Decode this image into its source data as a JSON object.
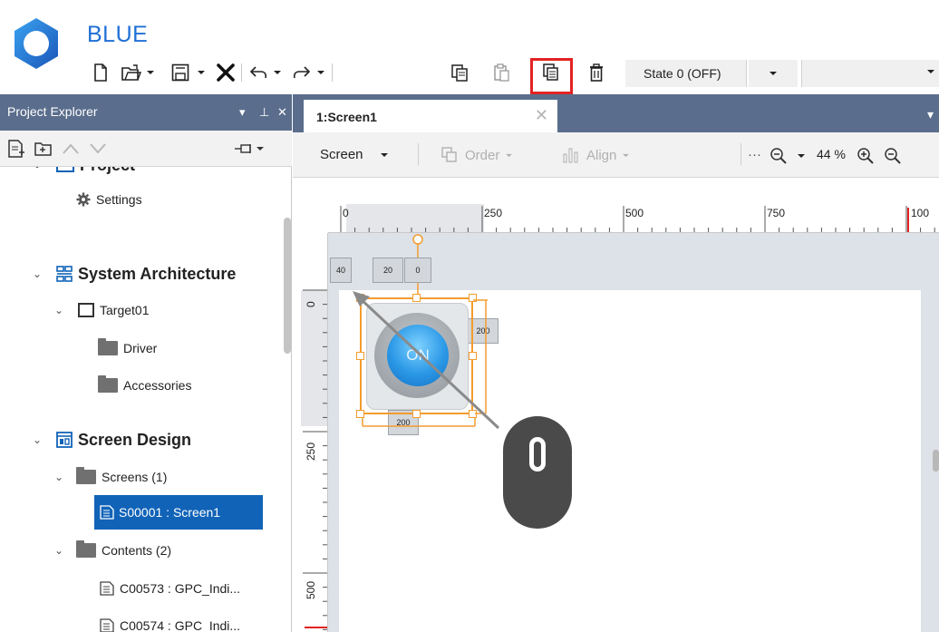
{
  "app": {
    "title": "BLUE",
    "brand_color": "#1f6fd6",
    "header_color": "#5a6d8c",
    "selection_color": "#1163b8",
    "highlight_color": "#e32222"
  },
  "toolbar": {
    "icons": [
      "new-file-icon",
      "open-icon",
      "save-icon",
      "delete-x-icon",
      "undo-icon",
      "redo-icon",
      "copy-icon",
      "paste-icon",
      "duplicate-icon",
      "trash-icon"
    ],
    "state_select": "State 0 (OFF)"
  },
  "project_explorer": {
    "title": "Project Explorer",
    "pin_glyph": "▾ ⊥ ✕",
    "tree": {
      "project_label": "Project",
      "settings": "Settings",
      "system_architecture": "System Architecture",
      "target": "Target01",
      "driver": "Driver",
      "accessories": "Accessories",
      "screen_design": "Screen Design",
      "screens": "Screens (1)",
      "screen1": "S00001 : Screen1",
      "contents": "Contents (2)",
      "content1": "C00573 : GPC_Indi...",
      "content2": "C00574 : GPC_Indi..."
    }
  },
  "document": {
    "tab_label": "1:Screen1",
    "tab_close": "✕",
    "menu_glyph": "▾",
    "toolbar": {
      "screen_select": "Screen",
      "order": "Order",
      "align": "Align",
      "more": "···",
      "zoom": "44 %"
    },
    "ruler_top": [
      "0",
      "250",
      "500",
      "750",
      "100"
    ],
    "ruler_left": [
      "0",
      "250",
      "500"
    ],
    "dims": {
      "left": "40",
      "top_a": "20",
      "top_b": "0",
      "height": "200",
      "width": "200"
    },
    "button_text": "ON"
  }
}
